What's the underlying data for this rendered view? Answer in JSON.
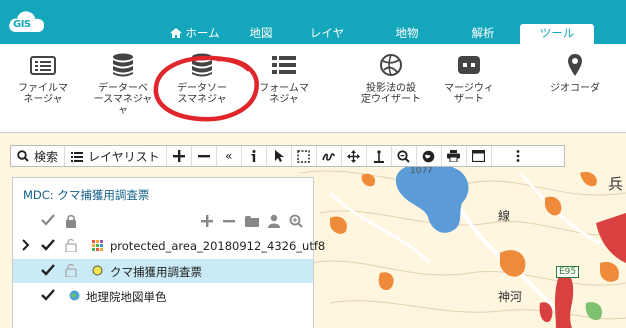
{
  "nav": {
    "logo_text": "GIS",
    "tabs": [
      {
        "label": "ホーム",
        "active": false
      },
      {
        "label": "地図",
        "active": false
      },
      {
        "label": "レイヤ",
        "active": false
      },
      {
        "label": "地物",
        "active": false
      },
      {
        "label": "解析",
        "active": false
      },
      {
        "label": "ツール",
        "active": true
      }
    ]
  },
  "ribbon": {
    "buttons": [
      {
        "label": "ファイルマ\nネージャ",
        "icon": "file-list-icon"
      },
      {
        "label": "データーベ\nースマネジャ\nャ",
        "icon": "database-icon"
      },
      {
        "label": "データソー\nスマネジャ",
        "icon": "database-icon",
        "highlighted": true
      },
      {
        "label": "フォームマ\nネジャ",
        "icon": "form-list-icon"
      },
      {
        "label": "投影法の設\n定ウイザート",
        "icon": "globe-icon"
      },
      {
        "label": "マージウィ\nザート",
        "icon": "merge-icon"
      },
      {
        "label": "ジオコーダ",
        "icon": "map-pin-icon"
      }
    ]
  },
  "toolbar": {
    "search_label": "検索",
    "layerlist_label": "レイヤリスト",
    "collapse_label": "«"
  },
  "map": {
    "labels": {
      "elevation": "1077",
      "kanji_right": "兵",
      "road_label": "線",
      "place": "神河",
      "route": "E95"
    }
  },
  "panel": {
    "title": "MDC: クマ捕獲用調査票",
    "layers": [
      {
        "name": "protected_area_20180912_4326_utf8",
        "checked": true,
        "expandable": true
      },
      {
        "name": "クマ捕獲用調査票",
        "checked": true,
        "selected": true
      },
      {
        "name": "地理院地図単色",
        "checked": true
      }
    ]
  },
  "colors": {
    "brand": "#14a7bb",
    "highlight_circle": "#e0262b",
    "selected_row": "#c9eaf6"
  }
}
